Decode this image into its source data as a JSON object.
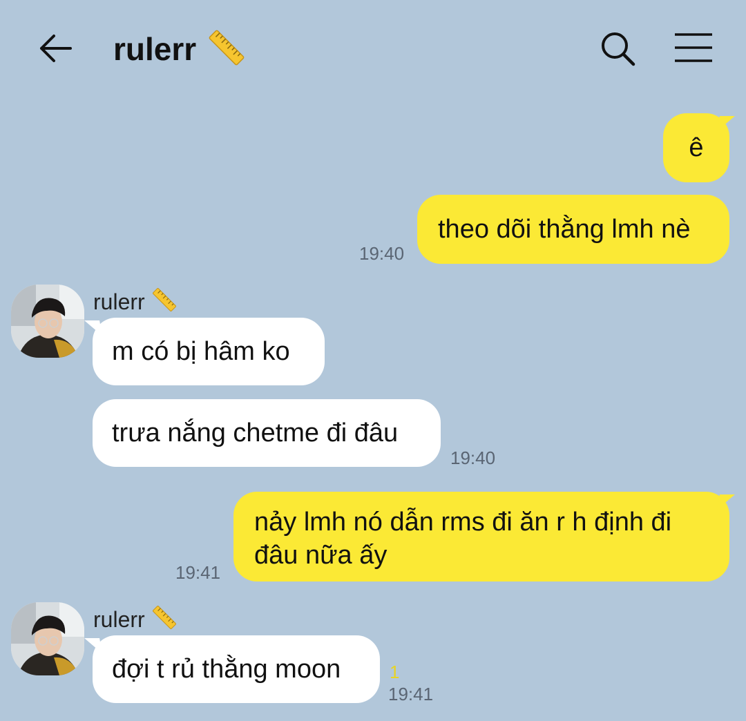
{
  "header": {
    "title": "rulerr",
    "title_emoji": "ruler-emoji",
    "back_icon": "back-arrow-icon",
    "search_icon": "search-icon",
    "menu_icon": "hamburger-menu-icon"
  },
  "colors": {
    "background": "#b2c7da",
    "my_bubble": "#fbe935",
    "their_bubble": "#ffffff",
    "timestamp": "#5a6573",
    "unread": "#e8d423"
  },
  "messages": [
    {
      "from": "me",
      "text": "ê"
    },
    {
      "from": "me",
      "text": "theo dõi thằng lmh nè",
      "time": "19:40"
    },
    {
      "from": "them",
      "sender": "rulerr",
      "text": "m có bị hâm ko"
    },
    {
      "from": "them",
      "text": "trưa nắng chetme đi đâu",
      "time": "19:40"
    },
    {
      "from": "me",
      "text_line1": "nảy lmh nó dẫn rms đi ăn r h định đi",
      "text_line2": "đâu nữa ấy",
      "time": "19:41"
    },
    {
      "from": "them",
      "sender": "rulerr",
      "text": "đợi t rủ thằng moon",
      "unread": "1",
      "time": "19:41"
    }
  ]
}
